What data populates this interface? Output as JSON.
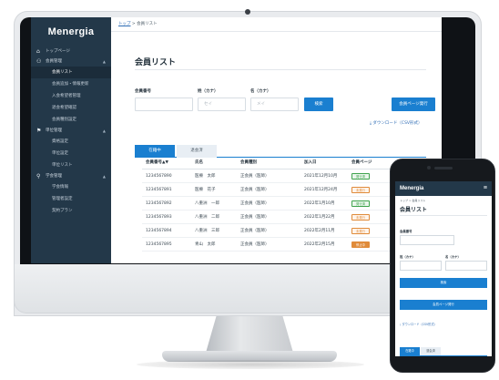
{
  "app": {
    "logo": "Menergia"
  },
  "breadcrumb": {
    "home": "トップ",
    "sep": " > ",
    "current": "会員リスト"
  },
  "sidebar": {
    "home": "トップページ",
    "groups": [
      {
        "label": "会員管理",
        "icon": "users-icon",
        "items": [
          "会員リスト",
          "会員追加・情報更新",
          "入会希望者管理",
          "退会希望確認",
          "会員種別設定"
        ]
      },
      {
        "label": "単位管理",
        "icon": "flag-icon",
        "items": [
          "資格設定",
          "単位設定",
          "単位リスト"
        ]
      },
      {
        "label": "学会管理",
        "icon": "pin-icon",
        "items": [
          "学会情報",
          "管理者設定",
          "契約プラン"
        ]
      }
    ]
  },
  "page": {
    "title": "会員リスト"
  },
  "search": {
    "member_no_label": "会員番号",
    "sei_label": "姓（カナ）",
    "mei_label": "名（カナ）",
    "sei_placeholder": "セイ",
    "mei_placeholder": "メイ",
    "search_button": "検索",
    "issue_button": "会員ページ発行",
    "download_link": "ダウンロード（CSV形式）"
  },
  "tabs": [
    {
      "label": "在籍中"
    },
    {
      "label": "退会済"
    }
  ],
  "table": {
    "headers": [
      "会員番号▲▼",
      "氏名",
      "会員種別",
      "加入日",
      "会員ページ"
    ],
    "rows": [
      {
        "no": "1234567890",
        "name": "医療　太郎",
        "type": "正会員（医師）",
        "date": "2021年12月10月",
        "status": "発行済",
        "kind": "ok"
      },
      {
        "no": "1234567891",
        "name": "医療　花子",
        "type": "正会員（医師）",
        "date": "2021年12月24月",
        "status": "未発行",
        "kind": "stop"
      },
      {
        "no": "1234567892",
        "name": "八重洲　一郎",
        "type": "正会員（医師）",
        "date": "2022年1月10月",
        "status": "発行済",
        "kind": "ok"
      },
      {
        "no": "1234567893",
        "name": "八重洲　二郎",
        "type": "正会員（医師）",
        "date": "2022年1月22月",
        "status": "未発行",
        "kind": "stop"
      },
      {
        "no": "1234567894",
        "name": "八重洲　三郎",
        "type": "正会員（医師）",
        "date": "2022年2月11月",
        "status": "未発行",
        "kind": "stop"
      },
      {
        "no": "1234567895",
        "name": "青山　太郎",
        "type": "正会員（医師）",
        "date": "2022年2月15月",
        "status": "停止中",
        "kind": "ng"
      }
    ]
  },
  "mobile": {
    "logo": "Menergia",
    "breadcrumb": "トップ > 会員リスト",
    "title": "会員リスト",
    "member_no_label": "会員番号",
    "sei_label": "姓（カナ）",
    "mei_label": "名（カナ）",
    "search_button": "検索",
    "issue_button": "会員ページ発行",
    "download_link": "ダウンロード（CSV形式）",
    "tabs": [
      "在籍中",
      "退会済"
    ]
  },
  "colors": {
    "sidebar": "#233849",
    "accent": "#1a7fd0",
    "issued": "#3fa34d",
    "unissued": "#e08b3a"
  }
}
